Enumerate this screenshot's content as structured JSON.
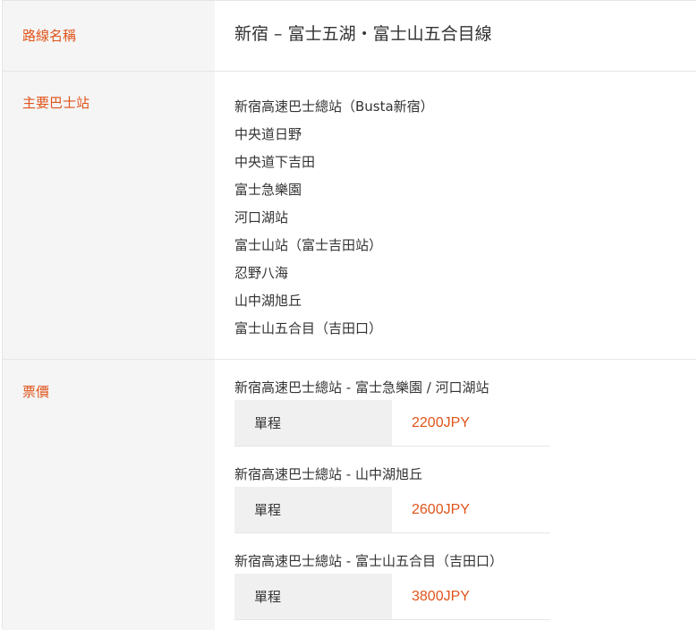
{
  "route": {
    "label": "路線名稱",
    "value": "新宿 – 富士五湖・富士山五合目線"
  },
  "stops": {
    "label": "主要巴士站",
    "items": [
      "新宿高速巴士總站（Busta新宿）",
      "中央道日野",
      "中央道下吉田",
      "富士急樂園",
      "河口湖站",
      "富士山站（富士吉田站）",
      "忍野八海",
      "山中湖旭丘",
      "富士山五合目（吉田口）"
    ]
  },
  "fare": {
    "label": "票價",
    "groups": [
      {
        "route": "新宿高速巴士總站 - 富士急樂園 / 河口湖站",
        "type": "單程",
        "price": "2200JPY"
      },
      {
        "route": "新宿高速巴士總站 - 山中湖旭丘",
        "type": "單程",
        "price": "2600JPY"
      },
      {
        "route": "新宿高速巴士總站 - 富士山五合目（吉田口）",
        "type": "單程",
        "price": "3800JPY"
      }
    ]
  },
  "colors": {
    "accent": "#e0541a",
    "label_bg": "#f5f5f5",
    "border": "#e6e6e6"
  }
}
